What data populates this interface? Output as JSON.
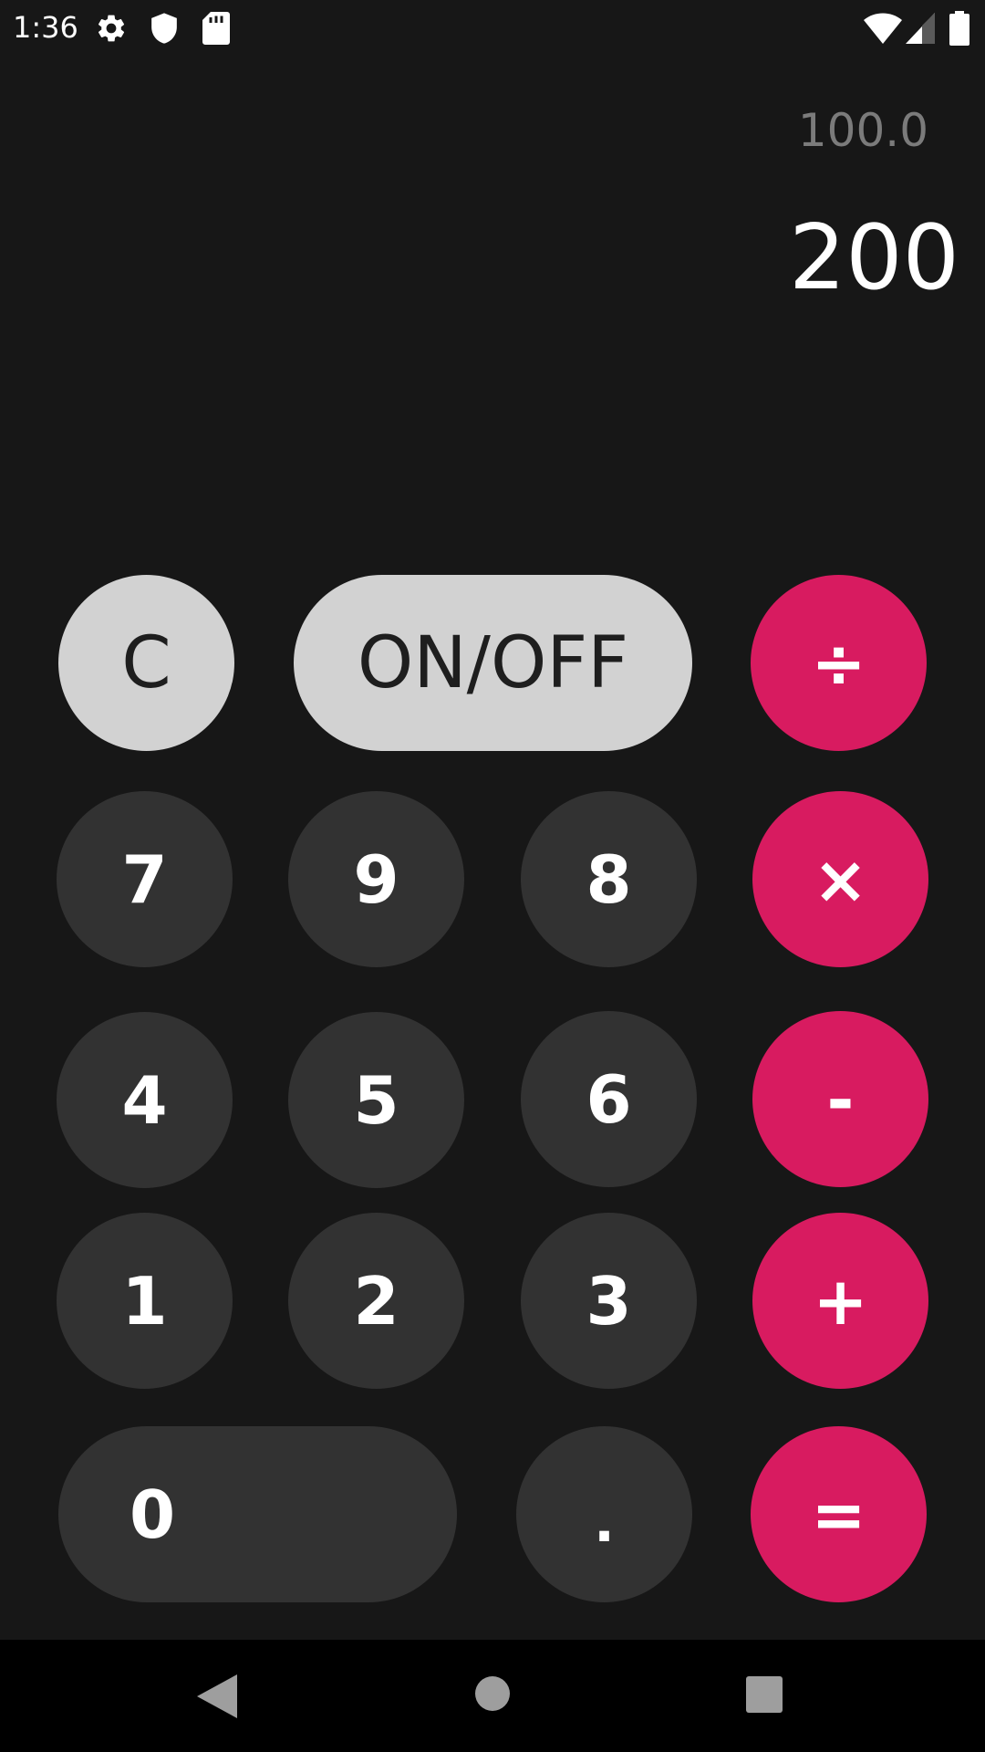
{
  "status_bar": {
    "time": "1:36",
    "icons": [
      "settings-icon",
      "shield-icon",
      "sd-card-icon",
      "wifi-icon",
      "cell-signal-icon",
      "battery-icon"
    ]
  },
  "display": {
    "previous_value": "100.0",
    "current_value": "200"
  },
  "keys": {
    "clear": "C",
    "on_off": "ON/OFF",
    "divide": "÷",
    "seven": "7",
    "nine": "9",
    "eight": "8",
    "multiply": "×",
    "four": "4",
    "five": "5",
    "six": "6",
    "minus": "-",
    "one": "1",
    "two": "2",
    "three": "3",
    "plus": "+",
    "zero": "0",
    "decimal": ".",
    "equals": "="
  },
  "nav_bar": {
    "buttons": [
      "back-icon",
      "home-icon",
      "recents-icon"
    ]
  },
  "colors": {
    "background": "#171717",
    "number_key": "#323232",
    "operator_key": "#d81b60",
    "function_key": "#d2d2d2",
    "secondary_text": "#7b7b7b"
  }
}
